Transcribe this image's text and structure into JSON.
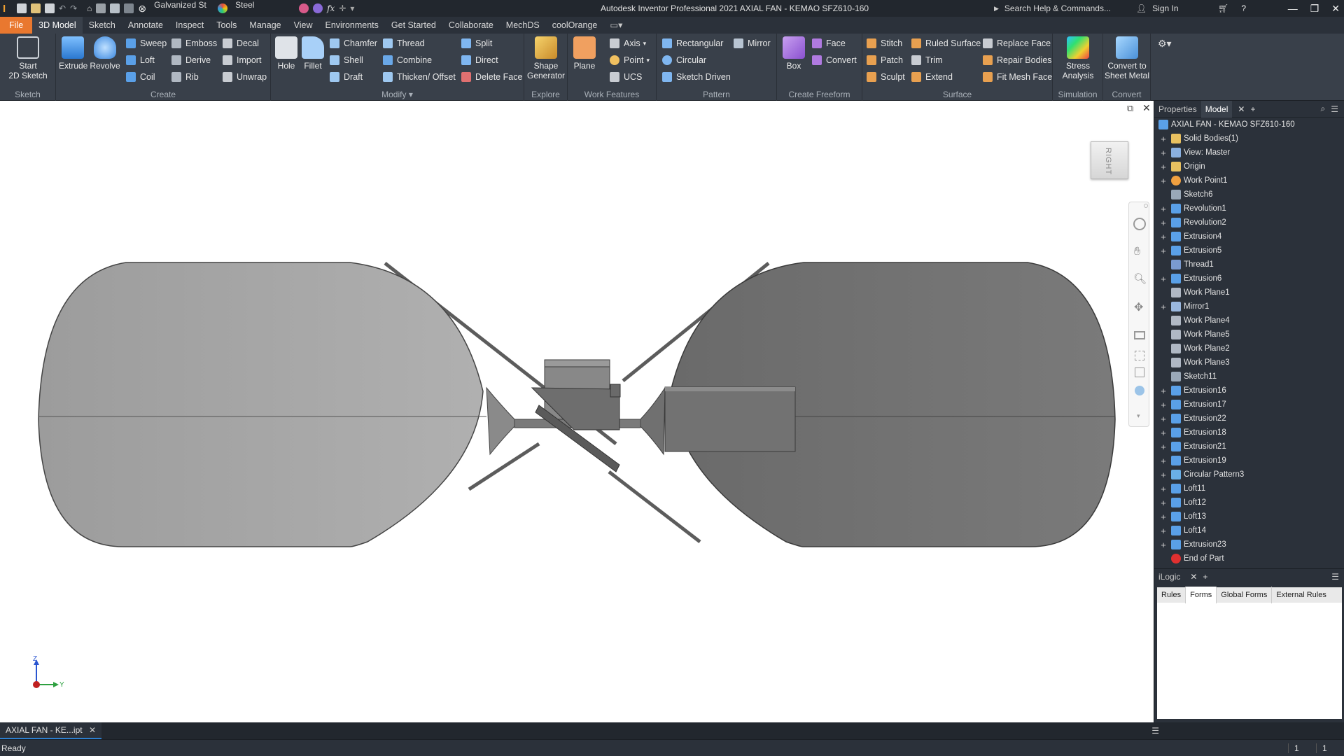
{
  "titlebar": {
    "material": "Galvanized St",
    "appearance": "Steel",
    "fx": "fx",
    "title": "Autodesk Inventor Professional 2021   AXIAL FAN - KEMAO SFZ610-160",
    "search_placeholder": "Search Help & Commands...",
    "sign_in": "Sign In"
  },
  "tabs": [
    "File",
    "3D Model",
    "Sketch",
    "Annotate",
    "Inspect",
    "Tools",
    "Manage",
    "View",
    "Environments",
    "Get Started",
    "Collaborate",
    "MechDS",
    "coolOrange"
  ],
  "ribbon": {
    "sketch": {
      "start_line1": "Start",
      "start_line2": "2D Sketch",
      "label": "Sketch"
    },
    "create": {
      "extrude": "Extrude",
      "revolve": "Revolve",
      "sweep": "Sweep",
      "loft": "Loft",
      "coil": "Coil",
      "emboss": "Emboss",
      "derive": "Derive",
      "rib": "Rib",
      "decal": "Decal",
      "import": "Import",
      "unwrap": "Unwrap",
      "label": "Create"
    },
    "modify": {
      "hole": "Hole",
      "fillet": "Fillet",
      "chamfer": "Chamfer",
      "shell": "Shell",
      "draft": "Draft",
      "thread": "Thread",
      "combine": "Combine",
      "thicken": "Thicken/ Offset",
      "split": "Split",
      "direct": "Direct",
      "delete_face": "Delete Face",
      "label": "Modify"
    },
    "explore": {
      "shape_line1": "Shape",
      "shape_line2": "Generator",
      "label": "Explore"
    },
    "work": {
      "plane": "Plane",
      "axis": "Axis",
      "point": "Point",
      "ucs": "UCS",
      "label": "Work Features"
    },
    "pattern": {
      "rectangular": "Rectangular",
      "circular": "Circular",
      "sketch_driven": "Sketch Driven",
      "mirror": "Mirror",
      "label": "Pattern"
    },
    "freeform": {
      "box": "Box",
      "face": "Face",
      "convert": "Convert",
      "label": "Create Freeform"
    },
    "surface": {
      "stitch": "Stitch",
      "patch": "Patch",
      "sculpt": "Sculpt",
      "ruled": "Ruled Surface",
      "trim": "Trim",
      "extend": "Extend",
      "replace": "Replace Face",
      "repair": "Repair Bodies",
      "fitmesh": "Fit Mesh Face",
      "label": "Surface"
    },
    "simulation": {
      "l1": "Stress",
      "l2": "Analysis",
      "label": "Simulation"
    },
    "convert": {
      "l1": "Convert to",
      "l2": "Sheet Metal",
      "label": "Convert"
    }
  },
  "viewcube": {
    "face": "RIGHT"
  },
  "axes": {
    "z": "Z",
    "y": "Y"
  },
  "browser": {
    "tabs": [
      "Properties",
      "Model"
    ],
    "root": "AXIAL FAN - KEMAO SFZ610-160",
    "items": [
      {
        "label": "Solid Bodies(1)",
        "exp": true,
        "icon": "folder"
      },
      {
        "label": "View: Master",
        "exp": true,
        "icon": "view"
      },
      {
        "label": "Origin",
        "exp": true,
        "icon": "folder"
      },
      {
        "label": "Work Point1",
        "exp": true,
        "icon": "point"
      },
      {
        "label": "Sketch6",
        "exp": false,
        "icon": "sketch"
      },
      {
        "label": "Revolution1",
        "exp": true,
        "icon": "revolve"
      },
      {
        "label": "Revolution2",
        "exp": true,
        "icon": "revolve"
      },
      {
        "label": "Extrusion4",
        "exp": true,
        "icon": "extrude"
      },
      {
        "label": "Extrusion5",
        "exp": true,
        "icon": "extrude"
      },
      {
        "label": "Thread1",
        "exp": false,
        "icon": "thread"
      },
      {
        "label": "Extrusion6",
        "exp": true,
        "icon": "extrude"
      },
      {
        "label": "Work Plane1",
        "exp": false,
        "icon": "plane"
      },
      {
        "label": "Mirror1",
        "exp": true,
        "icon": "mirror"
      },
      {
        "label": "Work Plane4",
        "exp": false,
        "icon": "plane"
      },
      {
        "label": "Work Plane5",
        "exp": false,
        "icon": "plane"
      },
      {
        "label": "Work Plane2",
        "exp": false,
        "icon": "plane"
      },
      {
        "label": "Work Plane3",
        "exp": false,
        "icon": "plane"
      },
      {
        "label": "Sketch11",
        "exp": false,
        "icon": "sketch"
      },
      {
        "label": "Extrusion16",
        "exp": true,
        "icon": "extrude"
      },
      {
        "label": "Extrusion17",
        "exp": true,
        "icon": "extrude"
      },
      {
        "label": "Extrusion22",
        "exp": true,
        "icon": "extrude"
      },
      {
        "label": "Extrusion18",
        "exp": true,
        "icon": "extrude"
      },
      {
        "label": "Extrusion21",
        "exp": true,
        "icon": "extrude"
      },
      {
        "label": "Extrusion19",
        "exp": true,
        "icon": "extrude"
      },
      {
        "label": "Circular Pattern3",
        "exp": true,
        "icon": "pattern"
      },
      {
        "label": "Loft11",
        "exp": true,
        "icon": "loft"
      },
      {
        "label": "Loft12",
        "exp": true,
        "icon": "loft"
      },
      {
        "label": "Loft13",
        "exp": true,
        "icon": "loft"
      },
      {
        "label": "Loft14",
        "exp": true,
        "icon": "loft"
      },
      {
        "label": "Extrusion23",
        "exp": true,
        "icon": "extrude"
      },
      {
        "label": "End of Part",
        "exp": false,
        "icon": "end"
      }
    ]
  },
  "ilogic": {
    "title": "iLogic",
    "tabs": [
      "Rules",
      "Forms",
      "Global Forms",
      "External Rules"
    ],
    "active": "Forms"
  },
  "document_tab": "AXIAL FAN - KE...ipt",
  "status": {
    "text": "Ready",
    "v1": "1",
    "v2": "1"
  },
  "colors": {
    "accent": "#e9782f",
    "ribbon": "#39404a",
    "panel": "#2b313a",
    "body_light": "#a8a8a8",
    "body_dark": "#6e6e6e"
  }
}
